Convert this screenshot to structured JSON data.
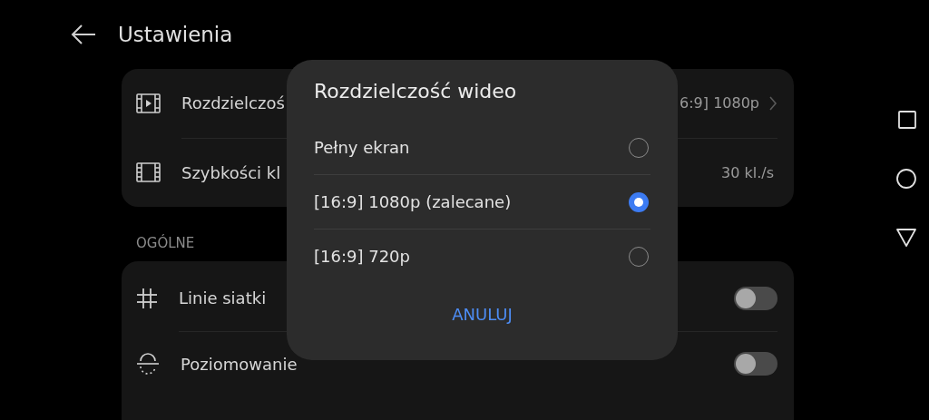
{
  "header": {
    "title": "Ustawienia"
  },
  "video_settings": {
    "items": [
      {
        "label": "Rozdzielczoś",
        "value": "6:9] 1080p",
        "kind": "link"
      },
      {
        "label": "Szybkości kl",
        "value": "30 kl./s",
        "kind": "value"
      }
    ]
  },
  "general": {
    "heading": "OGÓLNE",
    "items": [
      {
        "label": "Linie siatki",
        "on": false
      },
      {
        "label": "Poziomowanie",
        "on": false
      }
    ]
  },
  "dialog": {
    "title": "Rozdzielczość wideo",
    "options": [
      {
        "label": "Pełny ekran",
        "selected": false
      },
      {
        "label": "[16:9] 1080p (zalecane)",
        "selected": true
      },
      {
        "label": "[16:9] 720p",
        "selected": false
      }
    ],
    "cancel": "ANULUJ"
  }
}
